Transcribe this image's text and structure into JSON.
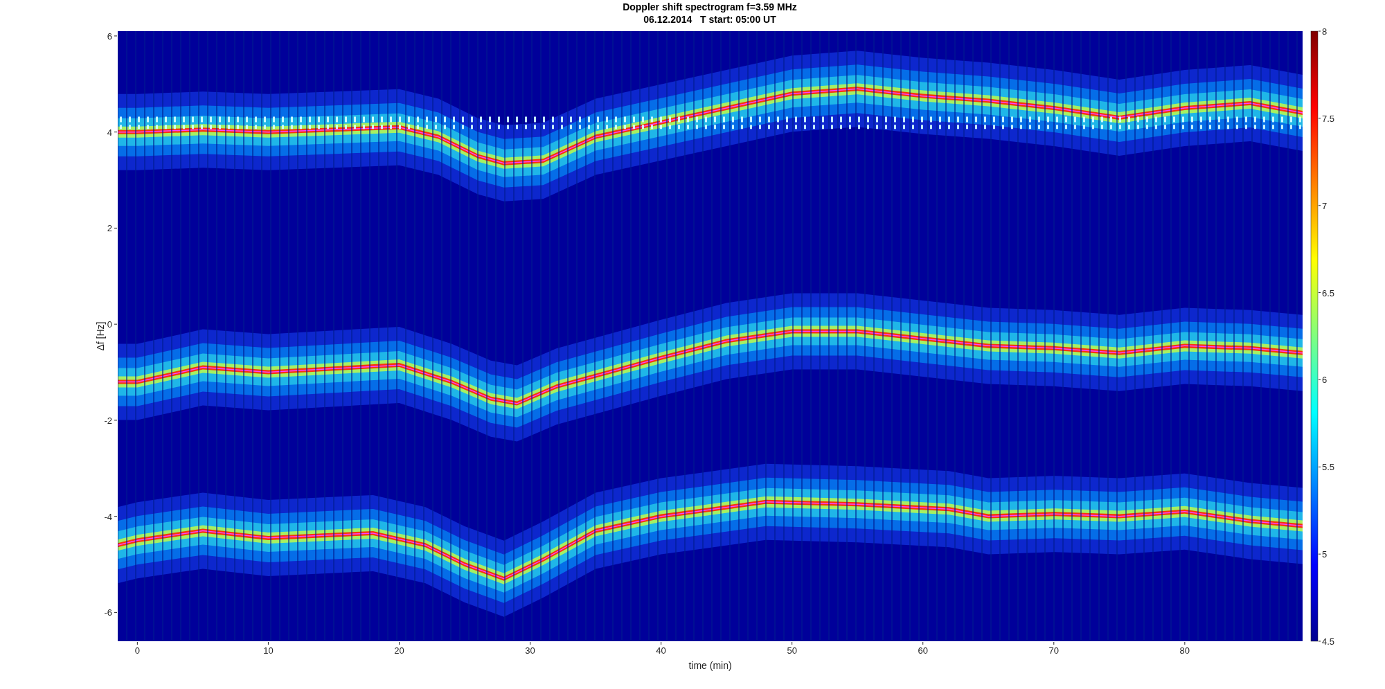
{
  "figure": {
    "title": "Doppler shift spectrogram f=3.59 MHz",
    "subtitle": "06.12.2014   T start: 05:00 UT",
    "xlabel": "time (min)",
    "ylabel": "Δf [Hz]",
    "xticks": [
      "0",
      "10",
      "20",
      "30",
      "40",
      "50",
      "60",
      "70",
      "80"
    ],
    "yticks": [
      "6",
      "4",
      "2",
      "0",
      "-2",
      "-4",
      "-6"
    ],
    "colorbar_ticks": [
      "8",
      "7.5",
      "7",
      "6.5",
      "6",
      "5.5",
      "5",
      "4.5"
    ]
  }
}
